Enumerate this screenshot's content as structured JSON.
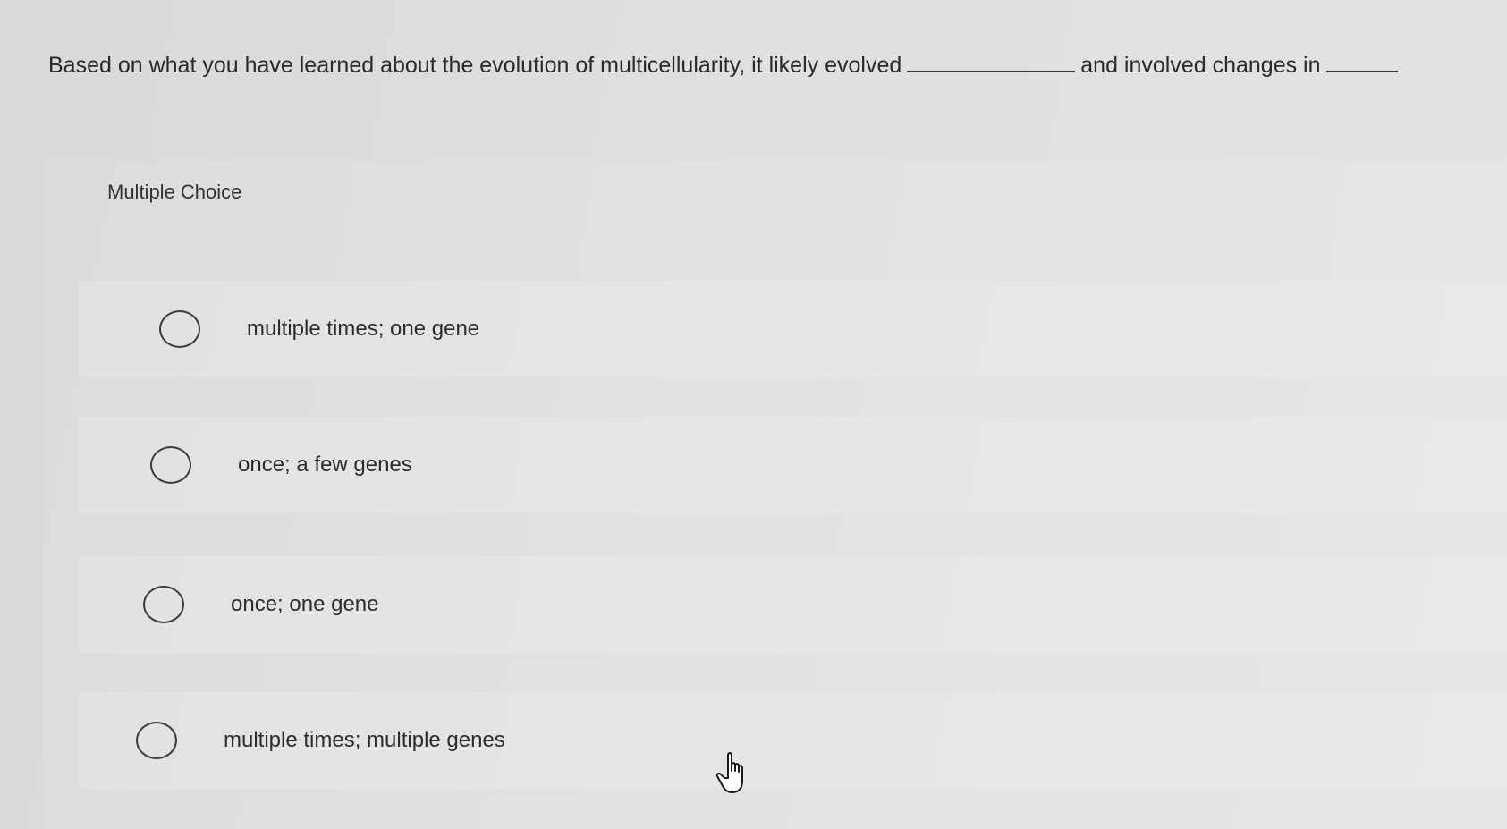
{
  "question": {
    "text_before": "Based on what you have learned about the evolution of multicellularity, it likely evolved",
    "text_middle": "and involved changes in"
  },
  "panel": {
    "title": "Multiple Choice",
    "options": [
      {
        "label": "multiple times; one gene"
      },
      {
        "label": "once; a few genes"
      },
      {
        "label": "once; one gene"
      },
      {
        "label": "multiple times; multiple genes"
      }
    ]
  },
  "icons": {
    "radio": "radio-button-icon",
    "cursor": "hand-pointer-cursor-icon"
  }
}
